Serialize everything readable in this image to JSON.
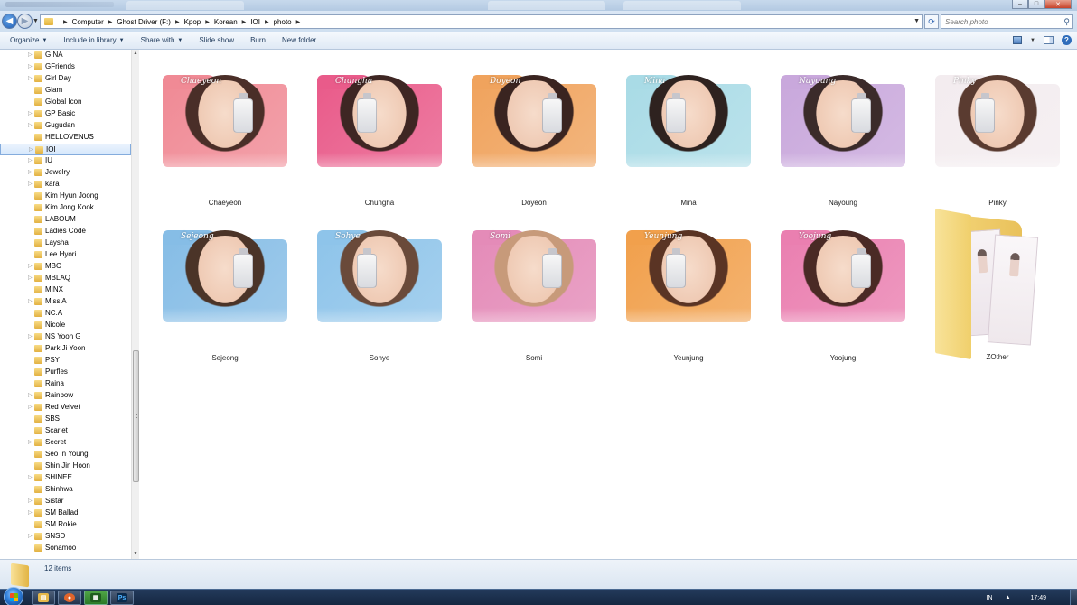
{
  "window": {
    "minimize_glyph": "–",
    "maximize_glyph": "□",
    "close_glyph": "✕"
  },
  "address": {
    "breadcrumbs": [
      "Computer",
      "Ghost Driver (F:)",
      "Kpop",
      "Korean",
      "IOI",
      "photo"
    ],
    "search_placeholder": "Search photo"
  },
  "toolbar": {
    "organize": "Organize",
    "include_in_library": "Include in library",
    "share_with": "Share with",
    "slide_show": "Slide show",
    "burn": "Burn",
    "new_folder": "New folder"
  },
  "sidebar": {
    "items": [
      "G.NA",
      "GFriends",
      "Girl Day",
      "Glam",
      "Global Icon",
      "GP Basic",
      "Gugudan",
      "HELLOVENUS",
      "IOI",
      "IU",
      "Jewelry",
      "kara",
      "Kim Hyun Joong",
      "Kim Jong Kook",
      "LABOUM",
      "Ladies Code",
      "Laysha",
      "Lee Hyori",
      "MBC",
      "MBLAQ",
      "MINX",
      "Miss A",
      "NC.A",
      "Nicole",
      "NS Yoon G",
      "Park Ji Yoon",
      "PSY",
      "Purfles",
      "Raina",
      "Rainbow",
      "Red Velvet",
      "SBS",
      "Scarlet",
      "Secret",
      "Seo In Young",
      "Shin Jin Hoon",
      "SHINEE",
      "Shinhwa",
      "Sistar",
      "SM Ballad",
      "SM Rokie",
      "SNSD",
      "Sonamoo"
    ],
    "expandable": [
      true,
      true,
      true,
      false,
      false,
      true,
      true,
      false,
      true,
      true,
      true,
      true,
      false,
      false,
      false,
      false,
      false,
      false,
      true,
      true,
      false,
      true,
      false,
      false,
      true,
      false,
      false,
      false,
      false,
      true,
      true,
      false,
      false,
      true,
      false,
      false,
      true,
      false,
      true,
      true,
      false,
      true,
      false
    ],
    "selected": "IOI"
  },
  "folders": [
    {
      "name": "Chaeyeon",
      "signature": "Chaeyeon",
      "bg": "#f08a95",
      "hair": "#4a2e28"
    },
    {
      "name": "Chungha",
      "signature": "Chungha",
      "bg": "#e95b8a",
      "hair": "#3e2623"
    },
    {
      "name": "Doyeon",
      "signature": "Doyeon",
      "bg": "#f0a35d",
      "hair": "#3a2420"
    },
    {
      "name": "Mina",
      "signature": "Mina",
      "bg": "#a9dbe6",
      "hair": "#2e221f"
    },
    {
      "name": "Nayoung",
      "signature": "Nayoung",
      "bg": "#c9a8dc",
      "hair": "#3b2b2a"
    },
    {
      "name": "Pinky",
      "signature": "Pinky",
      "bg": "#f3ecef",
      "hair": "#5a3b30"
    },
    {
      "name": "Sejeong",
      "signature": "Sejeong",
      "bg": "#86bde6",
      "hair": "#4b3428"
    },
    {
      "name": "Sohye",
      "signature": "Sohye",
      "bg": "#8ec4ea",
      "hair": "#6a4a3a"
    },
    {
      "name": "Somi",
      "signature": "Somi",
      "bg": "#e48bb8",
      "hair": "#c79a7a"
    },
    {
      "name": "Yeunjung",
      "signature": "Yeunjung",
      "bg": "#f1a04c",
      "hair": "#5a3424"
    },
    {
      "name": "Yoojung",
      "signature": "Yoojung",
      "bg": "#ea7fb0",
      "hair": "#4a2a25"
    }
  ],
  "other_folder": {
    "name": "ZOther"
  },
  "status": {
    "item_count": "12 items"
  },
  "taskbar": {
    "lang": "IN",
    "time": "17:49",
    "apps": [
      "explorer",
      "firefox",
      "calculator",
      "photoshop"
    ],
    "app_glyphs": [
      "▤",
      "●",
      "▦",
      "Ps"
    ]
  },
  "colors": {
    "selection": "#d6e8fc",
    "folder_yellow": "#f0cf6b"
  }
}
